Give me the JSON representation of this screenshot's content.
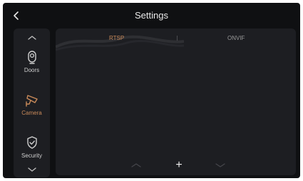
{
  "header": {
    "title": "Settings",
    "back_icon": "chevron-left-icon"
  },
  "sidebar": {
    "scroll_up_icon": "chevron-up-icon",
    "scroll_down_icon": "chevron-down-icon",
    "active_color": "#c98a5a",
    "items": [
      {
        "label": "Doors",
        "icon": "doorbell-camera-icon",
        "active": false
      },
      {
        "label": "Camera",
        "icon": "cctv-camera-icon",
        "active": true
      },
      {
        "label": "Security",
        "icon": "shield-check-icon",
        "active": false
      }
    ]
  },
  "main": {
    "tabs": [
      {
        "label": "RTSP",
        "active": true
      },
      {
        "label": "ONVIF",
        "active": false
      }
    ],
    "bottom_bar": {
      "prev_icon": "chevron-up-icon",
      "add_icon": "plus-icon",
      "add_label": "+",
      "next_icon": "chevron-down-icon"
    }
  },
  "colors": {
    "background": "#0f1012",
    "panel": "#1d1e22",
    "accent": "#c98a5a",
    "text": "#e9e9e9"
  }
}
